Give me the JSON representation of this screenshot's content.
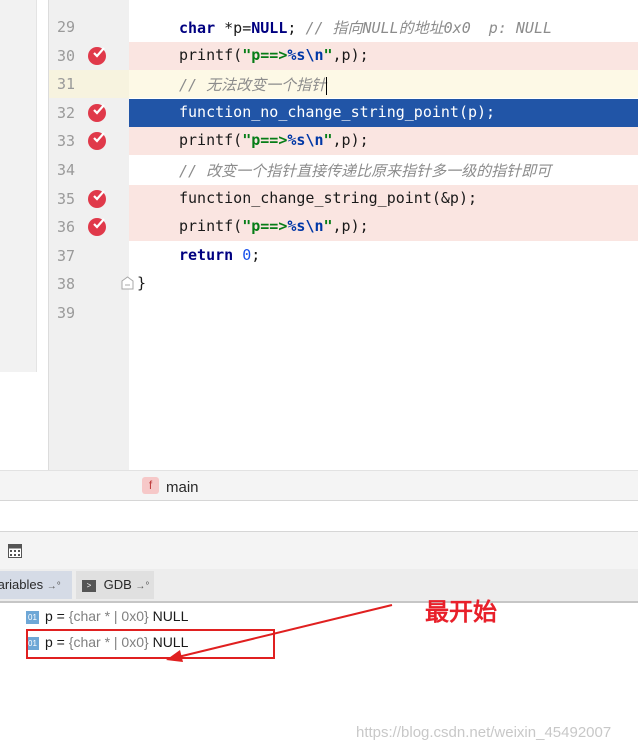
{
  "editor": {
    "lines": [
      {
        "num": "29",
        "bp": false,
        "style": "normal",
        "tokens": [
          {
            "t": "char",
            "c": "kw"
          },
          {
            "t": " *p="
          },
          {
            "t": "NULL",
            "c": "kw"
          },
          {
            "t": "; "
          },
          {
            "t": "// 指向NULL的地址0x0  p: NULL",
            "c": "cm"
          }
        ]
      },
      {
        "num": "30",
        "bp": true,
        "style": "bp",
        "tokens": [
          {
            "t": "printf("
          },
          {
            "t": "\"p==>",
            "c": "str"
          },
          {
            "t": "%s",
            "c": "esc"
          },
          {
            "t": "\\n",
            "c": "esc"
          },
          {
            "t": "\"",
            "c": "str"
          },
          {
            "t": ",p);"
          }
        ]
      },
      {
        "num": "31",
        "bp": false,
        "style": "cur",
        "caret": true,
        "tokens": [
          {
            "t": "// 无法改变一个指针",
            "c": "cm"
          }
        ]
      },
      {
        "num": "32",
        "bp": true,
        "style": "exec",
        "tokens": [
          {
            "t": "function_no_change_string_point(p);"
          }
        ]
      },
      {
        "num": "33",
        "bp": true,
        "style": "bp",
        "tokens": [
          {
            "t": "printf("
          },
          {
            "t": "\"p==>",
            "c": "str"
          },
          {
            "t": "%s",
            "c": "esc"
          },
          {
            "t": "\\n",
            "c": "esc"
          },
          {
            "t": "\"",
            "c": "str"
          },
          {
            "t": ",p);"
          }
        ]
      },
      {
        "num": "34",
        "bp": false,
        "style": "normal",
        "tokens": [
          {
            "t": "// 改变一个指针直接传递比原来指针多一级的指针即可",
            "c": "cm"
          }
        ]
      },
      {
        "num": "35",
        "bp": true,
        "style": "bp",
        "tokens": [
          {
            "t": "function_change_string_point(&p);"
          }
        ]
      },
      {
        "num": "36",
        "bp": true,
        "style": "bp",
        "tokens": [
          {
            "t": "printf("
          },
          {
            "t": "\"p==>",
            "c": "str"
          },
          {
            "t": "%s",
            "c": "esc"
          },
          {
            "t": "\\n",
            "c": "esc"
          },
          {
            "t": "\"",
            "c": "str"
          },
          {
            "t": ",p);"
          }
        ]
      },
      {
        "num": "37",
        "bp": false,
        "style": "normal",
        "tokens": [
          {
            "t": "return",
            "c": "kw"
          },
          {
            "t": " "
          },
          {
            "t": "0",
            "c": "num"
          },
          {
            "t": ";"
          }
        ]
      },
      {
        "num": "38",
        "bp": false,
        "style": "normal",
        "noindent": true,
        "tokens": [
          {
            "t": "}"
          }
        ]
      },
      {
        "num": "39",
        "bp": false,
        "style": "normal",
        "tokens": []
      }
    ]
  },
  "breadcrumb": {
    "icon_letter": "f",
    "function": "main"
  },
  "tabs": {
    "variables": "/ariables",
    "gdb": "GDB"
  },
  "variables": [
    {
      "icon": "01",
      "name": "p",
      "type": "{char * | 0x0}",
      "value": "NULL"
    },
    {
      "icon": "01",
      "name": "p",
      "type": "{char * | 0x0}",
      "value": "NULL"
    }
  ],
  "annotation": {
    "text": "最开始",
    "color": "#e8202a"
  },
  "watermark": "https://blog.csdn.net/weixin_45492007",
  "colors": {
    "breakpoint": "#e0394a",
    "exec_line": "#2155a7",
    "bp_line": "#fae5e1"
  }
}
